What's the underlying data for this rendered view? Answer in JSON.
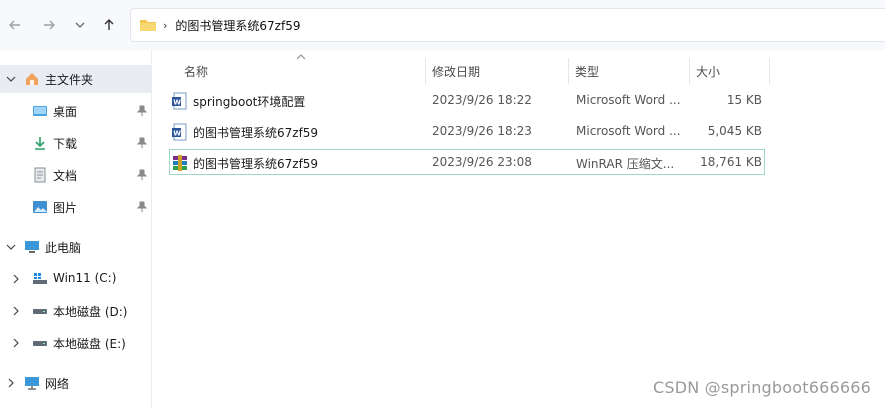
{
  "address": {
    "crumb": "的图书管理系统67zf59"
  },
  "sidebar": {
    "quick_access": "主文件夹",
    "pinned": [
      {
        "label": "桌面",
        "icon": "desktop-icon"
      },
      {
        "label": "下载",
        "icon": "download-icon"
      },
      {
        "label": "文档",
        "icon": "document-icon"
      },
      {
        "label": "图片",
        "icon": "picture-icon"
      }
    ],
    "this_pc": "此电脑",
    "drives": [
      {
        "label": "Win11 (C:)",
        "icon": "windows-drive-icon"
      },
      {
        "label": "本地磁盘 (D:)",
        "icon": "drive-icon"
      },
      {
        "label": "本地磁盘 (E:)",
        "icon": "drive-icon"
      }
    ],
    "network": "网络"
  },
  "columns": {
    "name": "名称",
    "modified": "修改日期",
    "type": "类型",
    "size": "大小"
  },
  "files": [
    {
      "name": "springboot环境配置",
      "modified": "2023/9/26 18:22",
      "type": "Microsoft Word ...",
      "size": "15 KB",
      "icon": "word-document-icon"
    },
    {
      "name": "的图书管理系统67zf59",
      "modified": "2023/9/26 18:23",
      "type": "Microsoft Word ...",
      "size": "5,045 KB",
      "icon": "word-document-icon"
    },
    {
      "name": "的图书管理系统67zf59",
      "modified": "2023/9/26 23:08",
      "type": "WinRAR 压缩文...",
      "size": "18,761 KB",
      "icon": "winrar-archive-icon"
    }
  ],
  "watermark": "CSDN @springboot666666"
}
